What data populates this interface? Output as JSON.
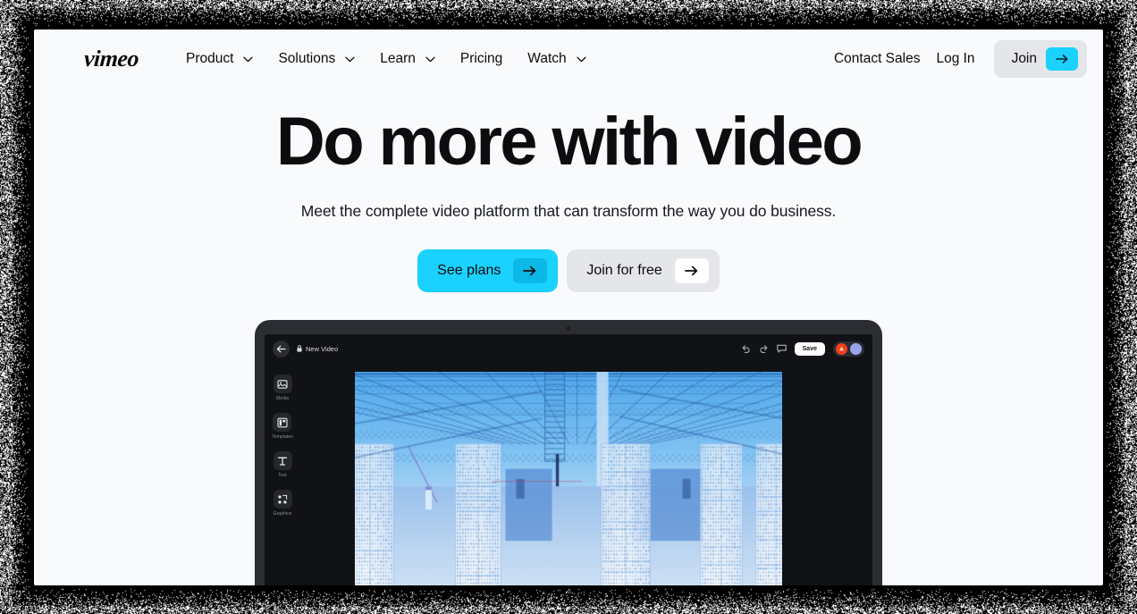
{
  "site": {
    "logo_text": "vimeo"
  },
  "header": {
    "nav": [
      {
        "label": "Product",
        "has_dropdown": true,
        "icon": "chevron-down-icon"
      },
      {
        "label": "Solutions",
        "has_dropdown": true,
        "icon": "chevron-down-icon"
      },
      {
        "label": "Learn",
        "has_dropdown": true,
        "icon": "chevron-down-icon"
      },
      {
        "label": "Pricing",
        "has_dropdown": false,
        "icon": ""
      },
      {
        "label": "Watch",
        "has_dropdown": true,
        "icon": "chevron-down-icon"
      }
    ],
    "contact_sales": "Contact Sales",
    "log_in": "Log In",
    "join": "Join",
    "join_arrow_icon": "arrow-right-icon"
  },
  "hero": {
    "title": "Do more with video",
    "subtitle": "Meet the complete video platform that can transform the way you do business.",
    "cta_primary": {
      "label": "See plans",
      "icon": "arrow-right-icon"
    },
    "cta_secondary": {
      "label": "Join for free",
      "icon": "arrow-right-icon"
    }
  },
  "editor_mockup": {
    "back_icon": "arrow-left-icon",
    "lock_icon": "lock-icon",
    "document_title": "New Video",
    "undo_icon": "undo-icon",
    "redo_icon": "redo-icon",
    "comment_icon": "comment-icon",
    "save_label": "Save",
    "avatars": [
      {
        "name": "avatar-red",
        "color": "#f2401b"
      },
      {
        "name": "avatar-purple",
        "color": "#9aa3ea"
      }
    ],
    "tools": [
      {
        "label": "Media",
        "icon": "media-icon"
      },
      {
        "label": "Templates",
        "icon": "templates-icon"
      },
      {
        "label": "Text",
        "icon": "text-icon"
      },
      {
        "label": "Graphics",
        "icon": "graphics-icon"
      }
    ],
    "canvas_description": "Blue-tinted data center interior with server racks and ceiling trusses"
  },
  "colors": {
    "accent_cyan": "#1ad1ff",
    "accent_cyan_dark": "#0bb8e6",
    "page_background": "#f9fafc",
    "neutral_pill": "#e4e6e9",
    "text_primary": "#0b0b0b",
    "laptop_body": "#2b2d32",
    "app_background": "#111216"
  }
}
